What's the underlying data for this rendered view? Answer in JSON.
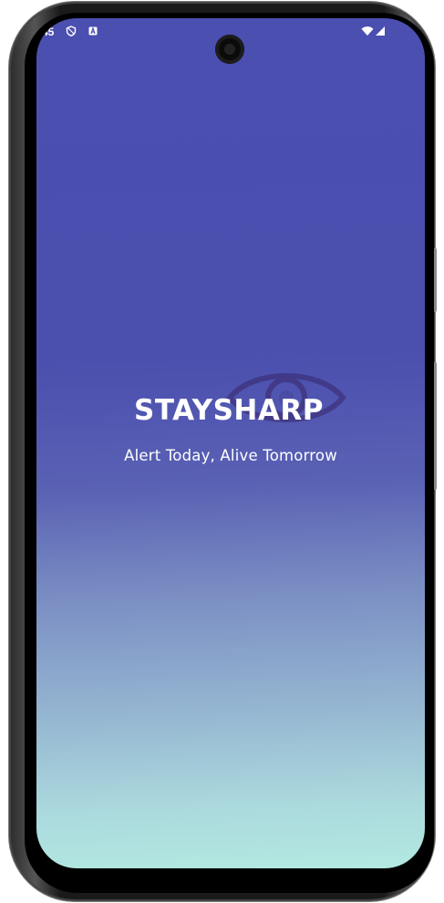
{
  "status_bar": {
    "time": "45",
    "icons": [
      "shield-icon",
      "notification-a-icon",
      "wifi-icon",
      "signal-icon"
    ]
  },
  "app": {
    "title": "STAYSHARP",
    "tagline": "Alert Today, Alive Tomorrow",
    "logo_icon": "eye-icon"
  },
  "colors": {
    "gradient_top": "#4a4fb0",
    "gradient_bottom": "#b3e9e1",
    "text": "#ffffff",
    "logo": "#3a2a70"
  }
}
